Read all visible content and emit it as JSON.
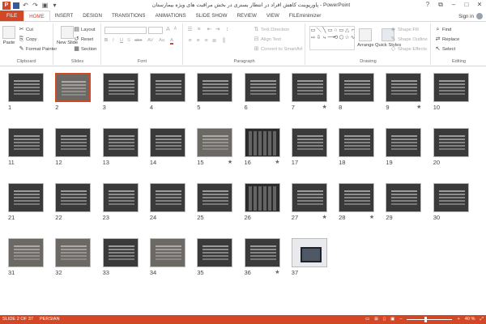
{
  "window": {
    "title": "پاورپوینت کاهش افراد در انتظار بستری در بخش مراقبت های ویژه بیمارستان - PowerPoint",
    "app_icon": "P",
    "controls": [
      "?",
      "⧉",
      "–",
      "□",
      "✕"
    ]
  },
  "tabs": [
    "FILE",
    "HOME",
    "INSERT",
    "DESIGN",
    "TRANSITIONS",
    "ANIMATIONS",
    "SLIDE SHOW",
    "REVIEW",
    "VIEW",
    "FILEminimizer"
  ],
  "active_tab": "HOME",
  "signin": "Sign in",
  "ribbon": {
    "clipboard": {
      "label": "Clipboard",
      "paste": "Paste",
      "cut": "Cut",
      "copy": "Copy",
      "format_painter": "Format Painter"
    },
    "slides": {
      "label": "Slides",
      "new_slide": "New Slide",
      "layout": "Layout",
      "reset": "Reset",
      "section": "Section"
    },
    "font": {
      "label": "Font",
      "bold": "B",
      "italic": "I",
      "underline": "U",
      "strike": "S",
      "abc": "abc",
      "spacing": "AV",
      "case": "Aa",
      "color": "A"
    },
    "paragraph": {
      "label": "Paragraph",
      "text_direction": "Text Direction",
      "align_text": "Align Text",
      "smartart": "Convert to SmartArt"
    },
    "drawing": {
      "label": "Drawing",
      "arrange": "Arrange",
      "quick_styles": "Quick Styles",
      "shape_fill": "Shape Fill",
      "shape_outline": "Shape Outline",
      "shape_effects": "Shape Effects",
      "shape_glyphs": [
        "▭",
        "＼",
        "╲",
        "▭",
        "○",
        "▭",
        "△",
        "⌐",
        "⇨",
        "⇩",
        "⤷",
        "⟶",
        "⟲",
        "⬡",
        "☆",
        "∿"
      ]
    },
    "editing": {
      "label": "Editing",
      "find": "Find",
      "replace": "Replace",
      "select": "Select"
    }
  },
  "slides": [
    {
      "n": "1",
      "star": ""
    },
    {
      "n": "2",
      "star": "",
      "selected": true
    },
    {
      "n": "3",
      "star": ""
    },
    {
      "n": "4",
      "star": ""
    },
    {
      "n": "5",
      "star": ""
    },
    {
      "n": "6",
      "star": ""
    },
    {
      "n": "7",
      "star": "★"
    },
    {
      "n": "8",
      "star": ""
    },
    {
      "n": "9",
      "star": "★"
    },
    {
      "n": "10",
      "star": ""
    },
    {
      "n": "11",
      "star": ""
    },
    {
      "n": "12",
      "star": ""
    },
    {
      "n": "13",
      "star": ""
    },
    {
      "n": "14",
      "star": ""
    },
    {
      "n": "15",
      "star": "★"
    },
    {
      "n": "16",
      "star": "★"
    },
    {
      "n": "17",
      "star": ""
    },
    {
      "n": "18",
      "star": ""
    },
    {
      "n": "19",
      "star": ""
    },
    {
      "n": "20",
      "star": ""
    },
    {
      "n": "21",
      "star": ""
    },
    {
      "n": "22",
      "star": ""
    },
    {
      "n": "23",
      "star": ""
    },
    {
      "n": "24",
      "star": ""
    },
    {
      "n": "25",
      "star": ""
    },
    {
      "n": "26",
      "star": ""
    },
    {
      "n": "27",
      "star": "★"
    },
    {
      "n": "28",
      "star": "★"
    },
    {
      "n": "29",
      "star": ""
    },
    {
      "n": "30",
      "star": ""
    },
    {
      "n": "31",
      "star": ""
    },
    {
      "n": "32",
      "star": ""
    },
    {
      "n": "33",
      "star": ""
    },
    {
      "n": "34",
      "star": ""
    },
    {
      "n": "35",
      "star": ""
    },
    {
      "n": "36",
      "star": "★"
    },
    {
      "n": "37",
      "star": ""
    }
  ],
  "status": {
    "slide": "SLIDE 2 OF 37",
    "language": "PERSIAN",
    "zoom": "40 %",
    "zoom_level": 0.4
  },
  "colors": {
    "accent": "#d24726"
  }
}
